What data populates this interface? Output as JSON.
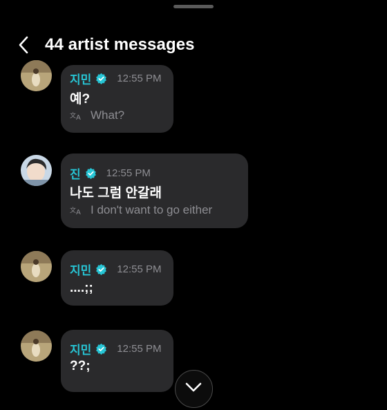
{
  "header": {
    "title": "44 artist messages"
  },
  "messages": [
    {
      "name": "지민",
      "time": "12:55 PM",
      "text": "예?",
      "translation": "What?"
    },
    {
      "name": "진",
      "time": "12:55 PM",
      "text": "나도 그럼 안갈래",
      "translation": "I don't want to go either"
    },
    {
      "name": "지민",
      "time": "12:55 PM",
      "text": "....;;",
      "translation": ""
    },
    {
      "name": "지민",
      "time": "12:55 PM",
      "text": "??;",
      "translation": ""
    }
  ],
  "colors": {
    "accent": "#27c6d6",
    "bubble": "#2a2a2c",
    "background": "#000000"
  },
  "icons": {
    "back": "chevron-left-icon",
    "verified": "verified-badge-icon",
    "translate": "translate-icon",
    "scroll": "chevron-down-icon"
  }
}
